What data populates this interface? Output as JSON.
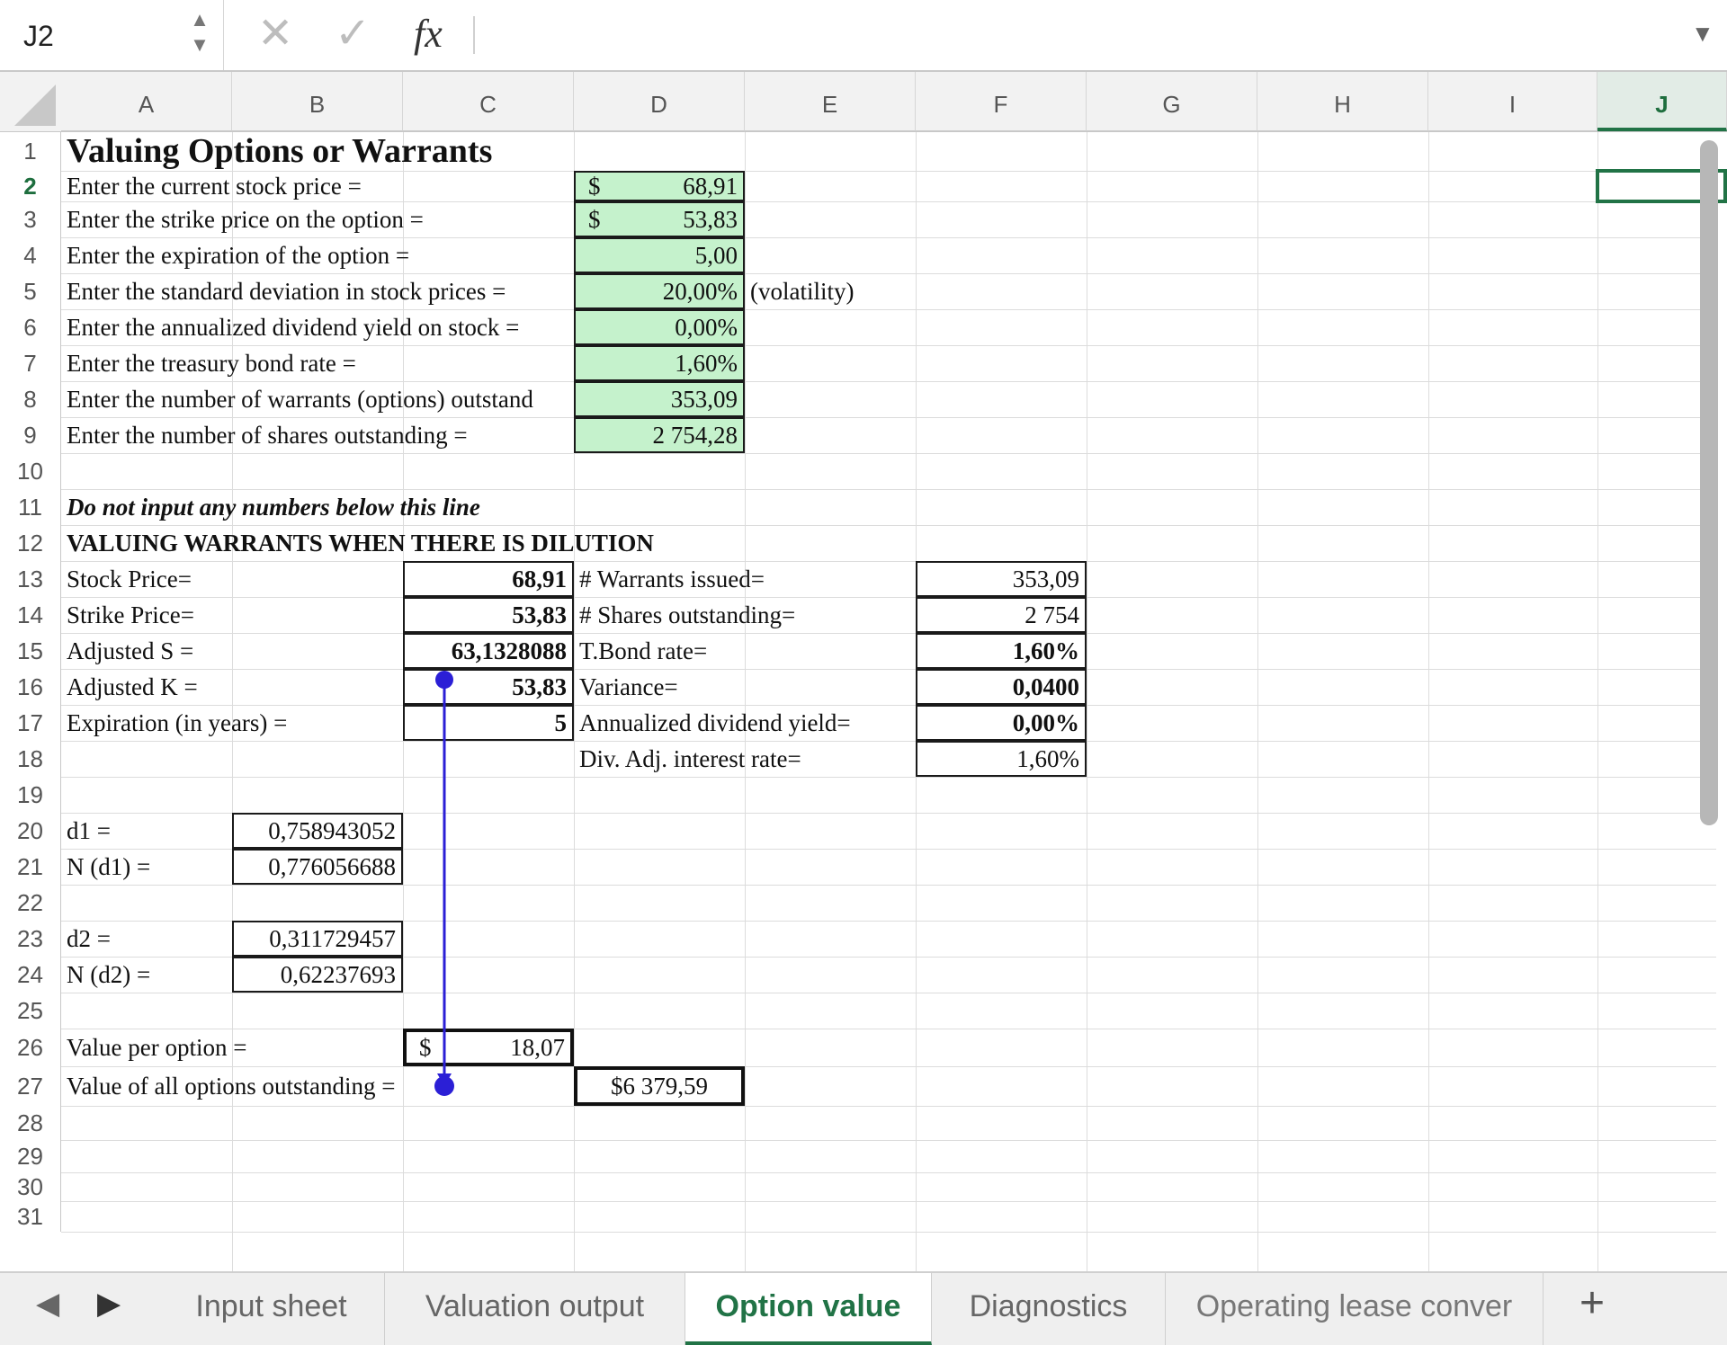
{
  "formula_bar": {
    "cell_ref": "J2",
    "stepper": "▲▼",
    "cancel_icon": "✕",
    "enter_icon": "✓",
    "fx_label": "fx",
    "formula": "",
    "dropdown": "▼"
  },
  "columns": [
    "A",
    "B",
    "C",
    "D",
    "E",
    "F",
    "G",
    "H",
    "I",
    "J"
  ],
  "selected_column": "J",
  "rows": [
    "1",
    "2",
    "3",
    "4",
    "5",
    "6",
    "7",
    "8",
    "9",
    "10",
    "11",
    "12",
    "13",
    "14",
    "15",
    "16",
    "17",
    "18",
    "19",
    "20",
    "21",
    "22",
    "23",
    "24",
    "25",
    "26",
    "27",
    "28",
    "29",
    "30",
    "31"
  ],
  "selected_row": "2",
  "cells": {
    "A1": "Valuing Options or Warrants",
    "A2": "Enter the current stock price =",
    "A3": "Enter the strike price on the option =",
    "A4": "Enter the expiration of the option =",
    "A5": "Enter the standard deviation in stock prices =",
    "A6": "Enter the annualized dividend yield on stock =",
    "A7": "Enter the treasury bond rate =",
    "A8": "Enter the number of warrants (options) outstand",
    "A9": "Enter the number of shares outstanding =",
    "D2_currency": "$",
    "D2": "68,91",
    "D3_currency": "$",
    "D3": "53,83",
    "D4": "5,00",
    "D5": "20,00%",
    "E5": "(volatility)",
    "D6": "0,00%",
    "D7": "1,60%",
    "D8": "353,09",
    "D9": "2 754,28",
    "A11": "Do not input any numbers below this line",
    "A12": "VALUING WARRANTS WHEN THERE IS DILUTION",
    "A13": "Stock Price=",
    "C13": "68,91",
    "D13": "# Warrants issued=",
    "F13": "353,09",
    "A14": "Strike Price=",
    "C14": "53,83",
    "D14": "# Shares outstanding=",
    "F14": "2 754",
    "A15": "Adjusted S =",
    "C15": "63,1328088",
    "D15": "T.Bond rate=",
    "F15": "1,60%",
    "A16": "Adjusted K =",
    "C16": "53,83",
    "D16": "Variance=",
    "F16": "0,0400",
    "A17": "Expiration (in years) =",
    "C17": "5",
    "D17": "Annualized dividend yield=",
    "F17": "0,00%",
    "D18": "Div. Adj. interest rate=",
    "F18": "1,60%",
    "A20": "d1 =",
    "B20": "0,758943052",
    "A21": "N (d1) =",
    "B21": "0,776056688",
    "A23": "d2 =",
    "B23": "0,311729457",
    "A24": "N (d2) =",
    "B24": "0,62237693",
    "A26": "Value per option =",
    "C26_currency": "$",
    "C26": "18,07",
    "A27": "Value of all options outstanding =",
    "D27": "$6 379,59"
  },
  "tabs": [
    {
      "label": "Input sheet",
      "active": false
    },
    {
      "label": "Valuation output",
      "active": false
    },
    {
      "label": "Option value",
      "active": true
    },
    {
      "label": "Diagnostics",
      "active": false
    },
    {
      "label": "Operating lease conver",
      "active": false
    }
  ],
  "tab_nav": {
    "prev": "◀",
    "next": "▶",
    "add": "+"
  },
  "colors": {
    "input_fill": "#c5f2cc",
    "accent_green": "#217346",
    "trace_arrow": "#2b1fd6"
  }
}
